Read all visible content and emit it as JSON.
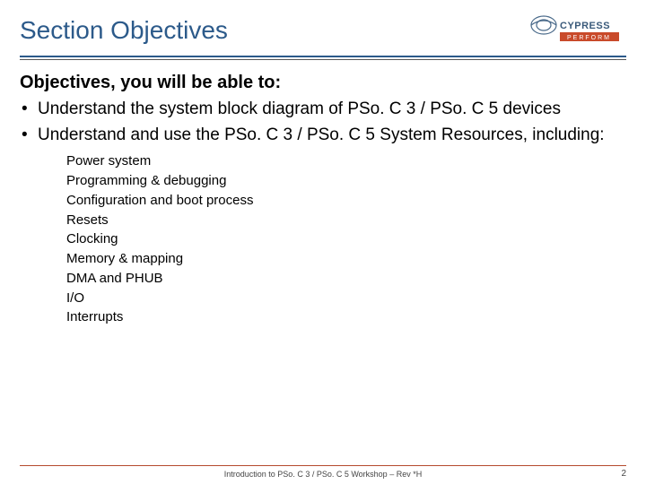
{
  "header": {
    "title": "Section Objectives",
    "logo_name": "Cypress",
    "logo_tag": "PERFORM"
  },
  "body": {
    "subtitle": "Objectives, you will be able to:",
    "bullets": [
      "Understand the system block diagram of PSo. C 3 / PSo. C 5 devices",
      "Understand and use the PSo. C 3 / PSo. C 5 System Resources, including:"
    ],
    "subbullets": [
      "Power system",
      "Programming & debugging",
      "Configuration and boot process",
      "Resets",
      "Clocking",
      "Memory & mapping",
      "DMA and PHUB",
      "I/O",
      "Interrupts"
    ]
  },
  "footer": {
    "text": "Introduction to PSo. C 3 / PSo. C 5 Workshop – Rev *H",
    "page": "2"
  }
}
